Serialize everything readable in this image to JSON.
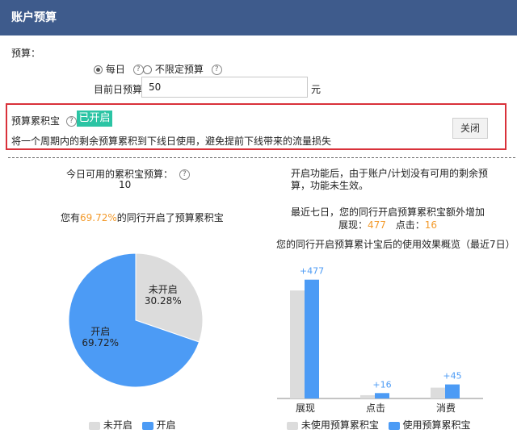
{
  "header": {
    "title": "账户预算"
  },
  "budget": {
    "label": "预算：",
    "daily_label": "每日",
    "unlimited_label": "不限定预算",
    "current_label": "目前日预算",
    "current_value": "50",
    "unit": "元"
  },
  "accumulator": {
    "label": "预算累积宝",
    "status": "已开启",
    "description": "将一个周期内的剩余预算累积到下线日使用，避免提前下线带来的流量损失",
    "close_label": "关闭"
  },
  "left_panel": {
    "available_label": "今日可用的累积宝预算：",
    "available_value": "10",
    "peer_text_prefix": "您有",
    "peer_percent": "69.72%",
    "peer_text_suffix": "的同行开启了预算累积宝"
  },
  "right_panel": {
    "note": "开启功能后，由于账户/计划没有可用的剩余预算，功能未生效。",
    "recent_title": "最近七日，您的同行开启预算累积宝额外增加",
    "impressions_label": "展现：",
    "impressions_value": "477",
    "clicks_label": "点击：",
    "clicks_value": "16",
    "chart_title": "您的同行开启预算累计宝后的使用效果概览（最近7日）"
  },
  "colors": {
    "on": "#4c9bf5",
    "off": "#dcdcdc",
    "accent": "#f39a2b",
    "header": "#3e5b8c"
  },
  "chart_data": [
    {
      "type": "pie",
      "slices": [
        {
          "name": "未开启",
          "value": 30.28,
          "label": "30.28%"
        },
        {
          "name": "开启",
          "value": 69.72,
          "label": "69.72%"
        }
      ],
      "legend": [
        "未开启",
        "开启"
      ],
      "legend_position": "bottom"
    },
    {
      "type": "bar",
      "categories": [
        "展现",
        "点击",
        "消费"
      ],
      "series": [
        {
          "name": "未使用预算累积宝",
          "values": [
            100,
            3,
            10
          ]
        },
        {
          "name": "使用预算累积宝",
          "values": [
            110,
            5,
            13
          ]
        }
      ],
      "data_labels": [
        "+477",
        "+16",
        "+45"
      ],
      "legend_position": "bottom"
    }
  ]
}
